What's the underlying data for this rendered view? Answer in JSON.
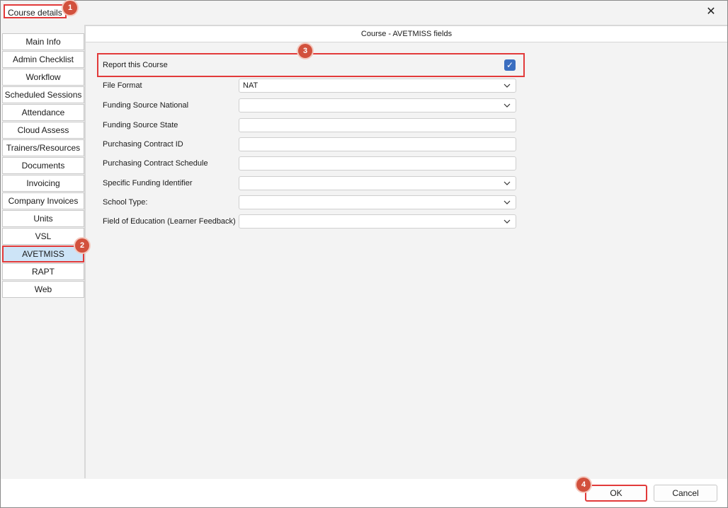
{
  "window": {
    "title": "Course details",
    "close_glyph": "✕"
  },
  "badges": [
    "1",
    "2",
    "3",
    "4"
  ],
  "sidebar": {
    "items": [
      {
        "label": "Main Info"
      },
      {
        "label": "Admin Checklist"
      },
      {
        "label": "Workflow"
      },
      {
        "label": "Scheduled Sessions"
      },
      {
        "label": "Attendance"
      },
      {
        "label": "Cloud Assess"
      },
      {
        "label": "Trainers/Resources"
      },
      {
        "label": "Documents"
      },
      {
        "label": "Invoicing"
      },
      {
        "label": "Company Invoices"
      },
      {
        "label": "Units"
      },
      {
        "label": "VSL"
      },
      {
        "label": "AVETMISS",
        "active": true
      },
      {
        "label": "RAPT"
      },
      {
        "label": "Web"
      }
    ]
  },
  "panel": {
    "header": "Course - AVETMISS fields",
    "report": {
      "label": "Report this Course",
      "checked": true,
      "check_glyph": "✓"
    },
    "fields": [
      {
        "label": "File Format",
        "value": "NAT",
        "type": "dropdown"
      },
      {
        "label": "Funding Source National",
        "value": "",
        "type": "dropdown"
      },
      {
        "label": "Funding Source State",
        "value": "",
        "type": "text"
      },
      {
        "label": "Purchasing Contract ID",
        "value": "",
        "type": "text"
      },
      {
        "label": "Purchasing Contract Schedule",
        "value": "",
        "type": "text"
      },
      {
        "label": "Specific Funding Identifier",
        "value": "",
        "type": "dropdown"
      },
      {
        "label": "School Type:",
        "value": "",
        "type": "dropdown"
      },
      {
        "label": "Field of Education (Learner Feedback)",
        "value": "",
        "type": "dropdown"
      }
    ]
  },
  "footer": {
    "ok_label": "OK",
    "cancel_label": "Cancel"
  },
  "colors": {
    "accent": "#3b6ec0",
    "highlight": "#e23a3a",
    "badge": "#d2513d",
    "active_tab": "#cde4f7"
  }
}
